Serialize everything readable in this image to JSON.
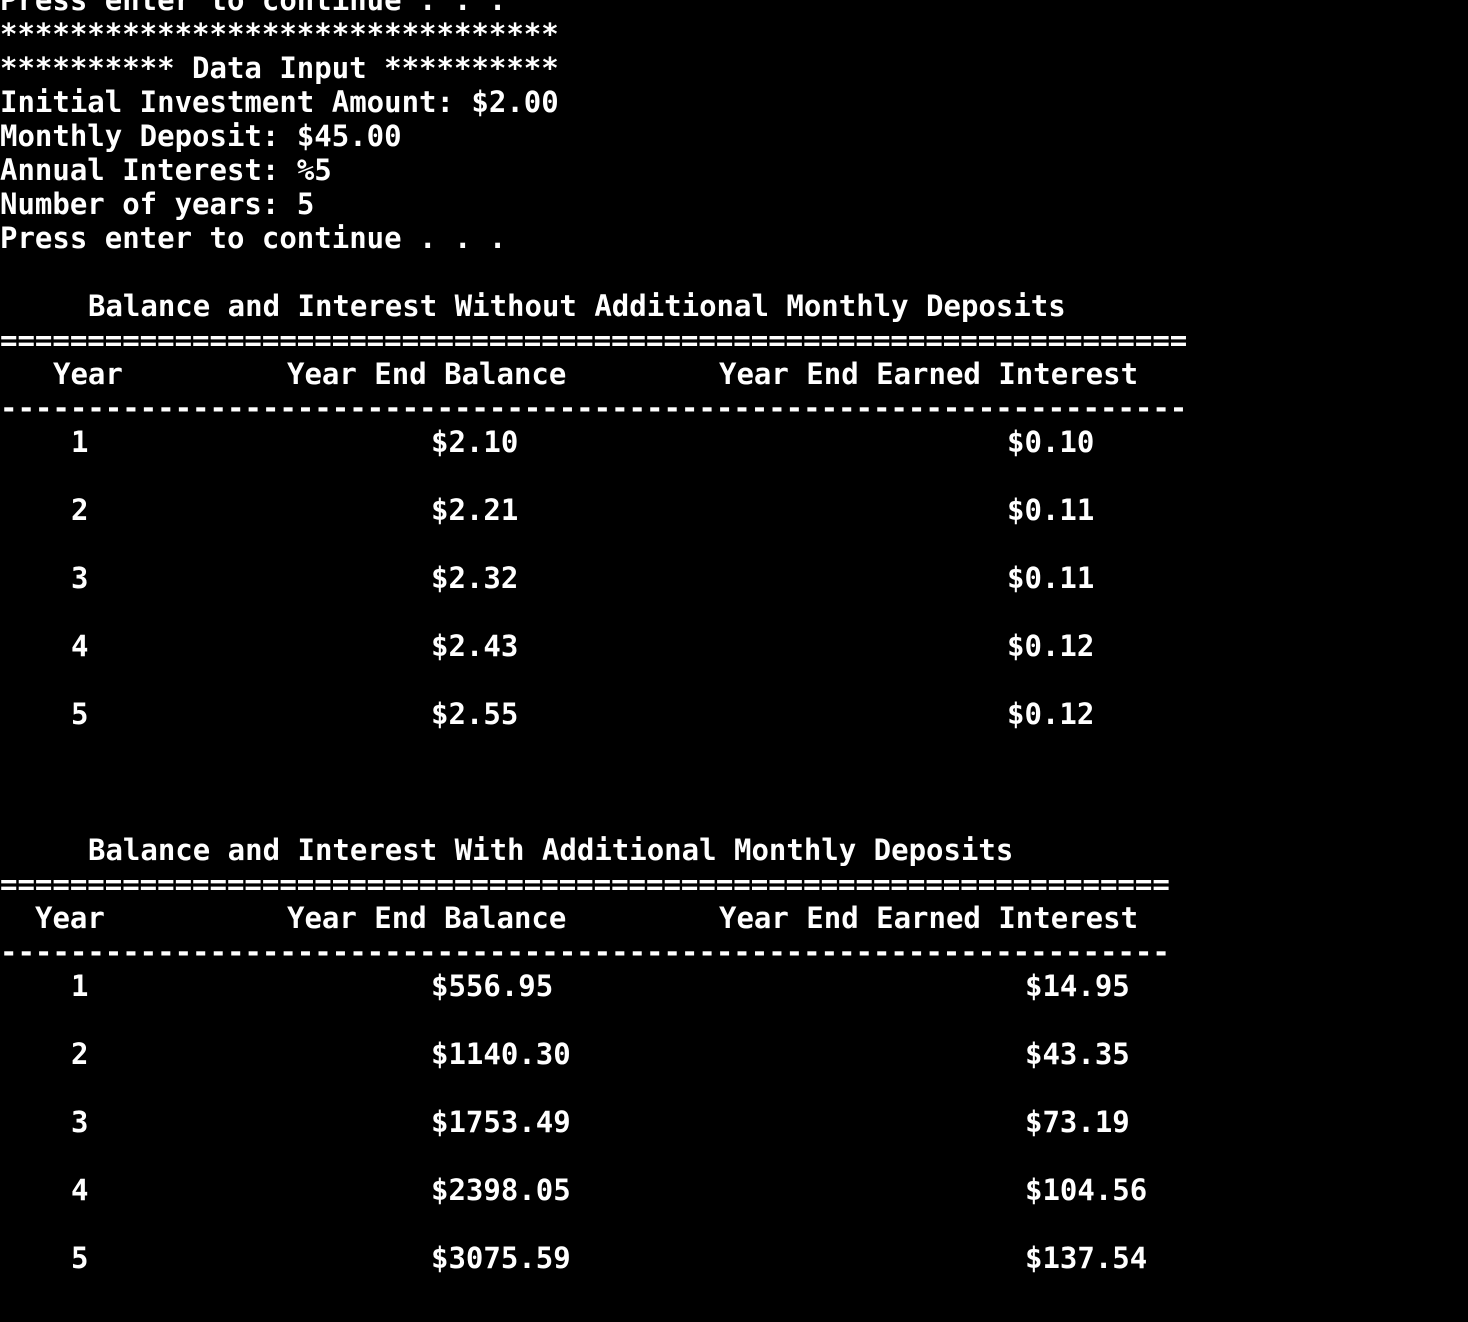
{
  "terminal": {
    "prompt_top": "Press enter to continue . . .",
    "stars_line": "********************************",
    "data_input_header": "********** Data Input **********",
    "fields": [
      {
        "label": "Initial Investment Amount: ",
        "value": "$2.00"
      },
      {
        "label": "Monthly Deposit: ",
        "value": "$45.00"
      },
      {
        "label": "Annual Interest: ",
        "value": "%5"
      },
      {
        "label": "Number of years: ",
        "value": "5"
      }
    ],
    "prompt_bottom": "Press enter to continue . . ."
  },
  "report1": {
    "title": "Balance and Interest Without Additional Monthly Deposits",
    "equals_rule": "====================================================================",
    "headers": {
      "year": "Year",
      "balance": "Year End Balance",
      "interest": "Year End Earned Interest"
    },
    "dash_rule": "--------------------------------------------------------------------",
    "rows": [
      {
        "year": "1",
        "balance": "$2.10",
        "interest": "$0.10"
      },
      {
        "year": "2",
        "balance": "$2.21",
        "interest": "$0.11"
      },
      {
        "year": "3",
        "balance": "$2.32",
        "interest": "$0.11"
      },
      {
        "year": "4",
        "balance": "$2.43",
        "interest": "$0.12"
      },
      {
        "year": "5",
        "balance": "$2.55",
        "interest": "$0.12"
      }
    ]
  },
  "report2": {
    "title": "Balance and Interest With Additional Monthly Deposits",
    "equals_rule": "===================================================================",
    "headers": {
      "year": "Year",
      "balance": "Year End Balance",
      "interest": "Year End Earned Interest"
    },
    "dash_rule": "-------------------------------------------------------------------",
    "rows": [
      {
        "year": "1",
        "balance": "$556.95",
        "interest": "$14.95"
      },
      {
        "year": "2",
        "balance": "$1140.30",
        "interest": "$43.35"
      },
      {
        "year": "3",
        "balance": "$1753.49",
        "interest": "$73.19"
      },
      {
        "year": "4",
        "balance": "$2398.05",
        "interest": "$104.56"
      },
      {
        "year": "5",
        "balance": "$3075.59",
        "interest": "$137.54"
      }
    ]
  }
}
